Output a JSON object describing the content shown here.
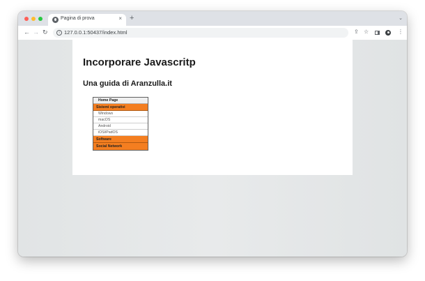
{
  "browser": {
    "tab": {
      "title": "Pagina di prova",
      "close_glyph": "×"
    },
    "new_tab_glyph": "+",
    "tab_search_glyph": "⌄",
    "toolbar": {
      "back_glyph": "←",
      "forward_glyph": "→",
      "reload_glyph": "↻",
      "info_glyph": "i",
      "url": "127.0.0.1:50437/index.html",
      "share_glyph": "⇪",
      "star_glyph": "☆",
      "menu_glyph": "⋮"
    },
    "traffic_lights": [
      "#fe5f57",
      "#febc2e",
      "#28c840"
    ]
  },
  "page": {
    "heading": "Incorporare Javascritp",
    "subheading": "Una guida di Aranzulla.it",
    "menu": {
      "accent_color": "#f47e20",
      "home": "Home Page",
      "sistemi": "Sistemi operativi",
      "sistemi_items": [
        "Windows",
        "macOS",
        "Android",
        "iOS/iPadOS"
      ],
      "software": "Software",
      "social": "Social Network"
    }
  }
}
